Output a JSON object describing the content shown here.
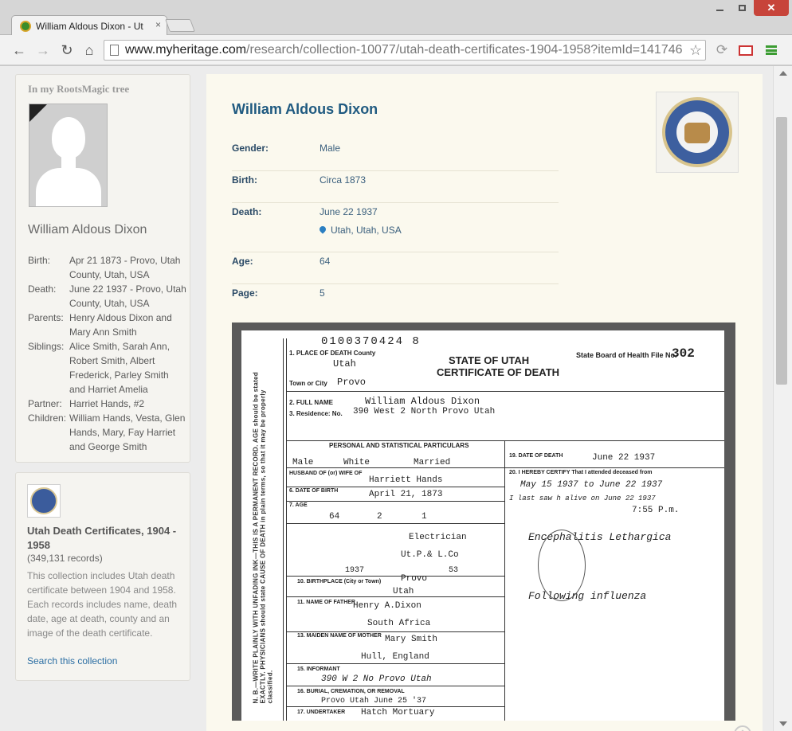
{
  "browser": {
    "tab_title": "William Aldous Dixon - Ut",
    "tab_close": "×",
    "window_close": "✕",
    "url_host": "www.myheritage.com",
    "url_path": "/research/collection-10077/utah-death-certificates-1904-1958?itemId=141746-"
  },
  "sidebar": {
    "tree_heading": "In my RootsMagic tree",
    "person_name": "William Aldous Dixon",
    "facts": [
      {
        "label": "Birth:",
        "value": "Apr 21 1873 - Provo, Utah County, Utah, USA"
      },
      {
        "label": "Death:",
        "value": "June 22 1937 - Provo, Utah County, Utah, USA"
      },
      {
        "label": "Parents:",
        "value": "Henry Aldous Dixon and Mary Ann Smith"
      },
      {
        "label": "Siblings:",
        "value": "Alice Smith, Sarah Ann, Robert Smith, Albert Frederick, Parley Smith and Harriet Amelia"
      },
      {
        "label": "Partner:",
        "value": "Harriet Hands, #2"
      },
      {
        "label": "Children:",
        "value": "William Hands, Vesta, Glen Hands, Mary, Fay Harriet and George Smith"
      }
    ],
    "collection": {
      "title": "Utah Death Certificates, 1904 - 1958",
      "count": "(349,131 records)",
      "description": "This collection includes Utah death certificate between 1904 and 1958. Each records includes name, death date, age at death, county and an image of the death certificate.",
      "link": "Search this collection"
    }
  },
  "record": {
    "name": "William Aldous Dixon",
    "gender_label": "Gender:",
    "gender": "Male",
    "birth_label": "Birth:",
    "birth": "Circa 1873",
    "death_label": "Death:",
    "death_date": "June 22 1937",
    "death_place": "Utah, Utah, USA",
    "age_label": "Age:",
    "age": "64",
    "page_label": "Page:",
    "page": "5"
  },
  "certificate": {
    "number": "0100370424 8",
    "state": "STATE OF UTAH",
    "title": "CERTIFICATE OF DEATH",
    "board": "State Board of Health File No.",
    "file_no": "302",
    "county_label": "1. PLACE OF DEATH   County",
    "county": "Utah",
    "city_label": "Town or City",
    "city": "Provo",
    "full_name_label": "2. FULL NAME",
    "full_name": "William Aldous Dixon",
    "residence_label": "3. Residence: No.",
    "residence": "390 West 2 North Provo Utah",
    "section": "PERSONAL AND STATISTICAL PARTICULARS",
    "sex": "Male",
    "color": "White",
    "marital": "Married",
    "spouse_label": "HUSBAND OF (or) WIFE OF",
    "spouse": "Harriett Hands",
    "dob_label": "6. DATE OF BIRTH",
    "dob": "April 21,   1873",
    "age_label": "7. AGE",
    "age_years": "64",
    "age_months": "2",
    "age_days": "1",
    "occupation": "Electrician",
    "industry": "Ut.P.& L.Co",
    "occ_year": "1937",
    "occ_years": "53",
    "birthplace_label": "10. BIRTHPLACE (City or Town)",
    "birthplace": "Provo",
    "birthplace_state": "Utah",
    "father_label": "11. NAME OF FATHER",
    "father": "Henry A.Dixon",
    "father_bp": "South Africa",
    "mother_label": "13. MAIDEN NAME OF MOTHER",
    "mother": "Mary Smith",
    "mother_bp": "Hull, England",
    "informant_label": "15. INFORMANT",
    "informant_addr": "390 W 2 No Provo Utah",
    "burial_label": "16. BURIAL, CREMATION, OR REMOVAL",
    "burial": "Provo Utah   June 25  '37",
    "undertaker_label": "17. UNDERTAKER",
    "undertaker": "Hatch Mortuary",
    "death_date_label": "19. DATE OF DEATH",
    "death_date": "June 22   1937",
    "certify": "20. I HEREBY CERTIFY That I attended deceased from",
    "attended_from": "May 15   1937 to June 22 1937",
    "saw_alive": "I last saw h  alive on   June 22  1937",
    "time": "7:55 P.m.",
    "cause": "Encephalitis Lethargica",
    "contrib": "Following influenza",
    "side_text": "N. B.—WRITE PLAINLY WITH UNFADING INK—THIS IS A PERMANENT RECORD. AGE should be stated EXACTLY. PHYSICIANS should state CAUSE OF DEATH in plain terms, so that it may be properly classified."
  }
}
